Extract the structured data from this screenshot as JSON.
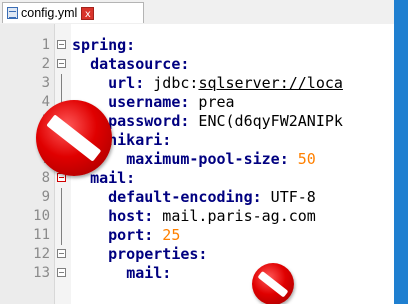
{
  "tab": {
    "title": "config.yml",
    "close_symbol": "x"
  },
  "editor_lines": [
    {
      "n": "1",
      "indent": "",
      "key": "spring:",
      "val": "",
      "fold": "box"
    },
    {
      "n": "2",
      "indent": "  ",
      "key": "datasource:",
      "val": "",
      "fold": "box"
    },
    {
      "n": "3",
      "indent": "    ",
      "key": "url:",
      "val": " jdbc:sqlserver://loca",
      "fold": "line"
    },
    {
      "n": "4",
      "indent": "    ",
      "key": "username:",
      "val": " prea",
      "fold": "line"
    },
    {
      "n": "5",
      "indent": "    ",
      "key": "password:",
      "val": " ENC(d6qyFW2ANIPk",
      "fold": "line"
    },
    {
      "n": "6",
      "indent": "    ",
      "key": "hikari:",
      "val": "",
      "fold": "box"
    },
    {
      "n": "7",
      "indent": "      ",
      "key": "maximum-pool-size:",
      "val": " 50",
      "fold": "line"
    },
    {
      "n": "8",
      "indent": "  ",
      "key": "mail:",
      "val": "",
      "fold": "redbox"
    },
    {
      "n": "9",
      "indent": "    ",
      "key": "default-encoding:",
      "val": " UTF-8",
      "fold": "line"
    },
    {
      "n": "10",
      "indent": "    ",
      "key": "host:",
      "val": " mail.paris-ag.com",
      "fold": "line"
    },
    {
      "n": "11",
      "indent": "    ",
      "key": "port:",
      "val": " 25",
      "fold": "line"
    },
    {
      "n": "12",
      "indent": "    ",
      "key": "properties:",
      "val": "",
      "fold": "box"
    },
    {
      "n": "13",
      "indent": "      ",
      "key": "mail:",
      "val": "",
      "fold": "box"
    }
  ],
  "colors": {
    "key": "#000080",
    "number": "#ff8000",
    "background": "#1f7fd0",
    "no_entry": "#e00000"
  },
  "icons": [
    "file-icon",
    "close-icon",
    "no-entry-icon"
  ]
}
